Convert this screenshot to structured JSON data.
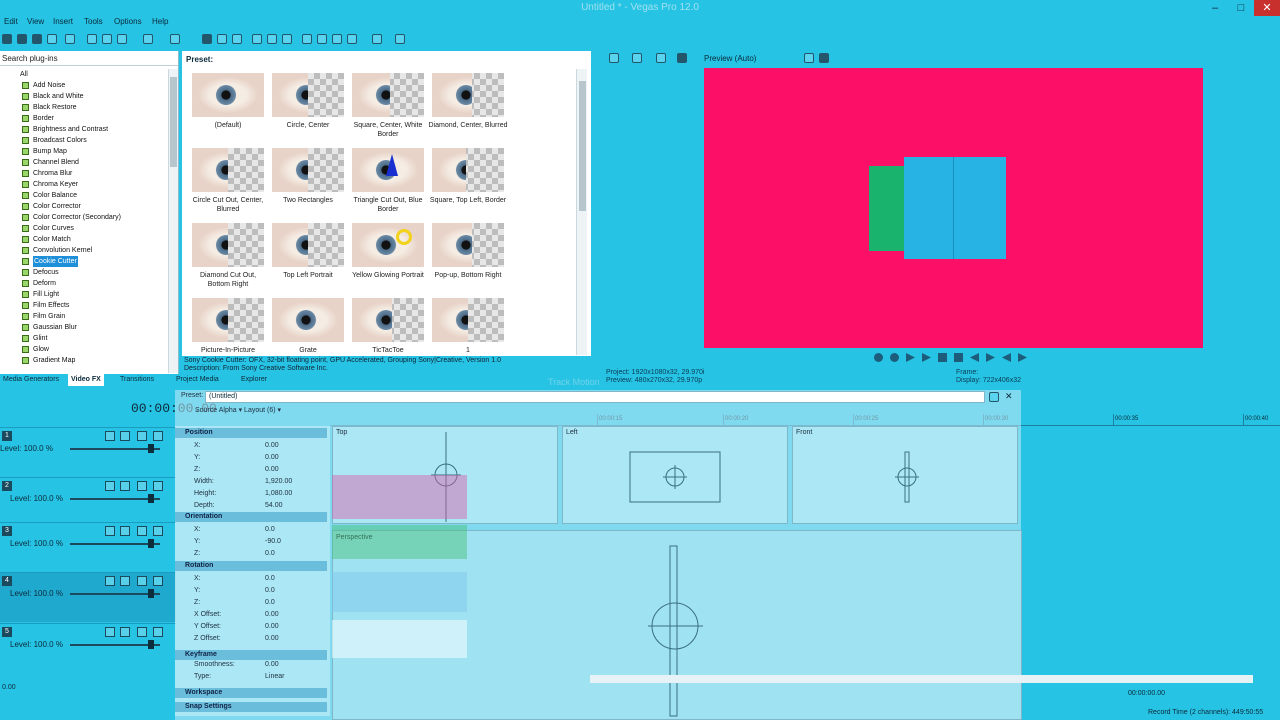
{
  "window": {
    "title": "Untitled * - Vegas Pro 12.0"
  },
  "menu": [
    "Edit",
    "View",
    "Insert",
    "Tools",
    "Options",
    "Help"
  ],
  "plugins": {
    "search_placeholder": "Search plug-ins",
    "root": "All",
    "items": [
      "Add Noise",
      "Black and White",
      "Black Restore",
      "Border",
      "Brightness and Contrast",
      "Broadcast Colors",
      "Bump Map",
      "Channel Blend",
      "Chroma Blur",
      "Chroma Keyer",
      "Color Balance",
      "Color Corrector",
      "Color Corrector (Secondary)",
      "Color Curves",
      "Color Match",
      "Convolution Kernel",
      "Cookie Cutter",
      "Defocus",
      "Deform",
      "Fill Light",
      "Film Effects",
      "Film Grain",
      "Gaussian Blur",
      "Glint",
      "Glow",
      "Gradient Map"
    ],
    "selected": "Cookie Cutter"
  },
  "presets": {
    "label": "Preset:",
    "items": [
      "(Default)",
      "Circle, Center",
      "Square, Center, White Border",
      "Diamond, Center, Blurred",
      "Circle Cut Out, Center, Blurred",
      "Two Rectangles",
      "Triangle Cut Out, Blue Border",
      "Square, Top Left, Border",
      "Diamond Cut Out, Bottom Right",
      "Top Left Portrait",
      "Yellow Glowing Portrait",
      "Pop-up, Bottom Right",
      "Picture-In-Picture",
      "Grate",
      "TicTacToe",
      "1"
    ],
    "description_line1": "Sony Cookie Cutter: OFX, 32-bit floating point, GPU Accelerated, Grouping Sony|Creative, Version 1.0",
    "description_line2": "Description: From Sony Creative Software Inc."
  },
  "bottom_tabs": [
    "Media Generators",
    "Video FX",
    "Transitions",
    "Project Media",
    "Explorer"
  ],
  "preview": {
    "mode": "Preview (Auto)",
    "project": "Project:   1920x1080x32, 29.970i",
    "preview": "Preview:  480x270x32, 29.970p",
    "frame_label": "Frame:",
    "display": "Display:   722x406x32",
    "bg_color": "#fb0f67",
    "shape_colors": [
      "#1ab36e",
      "#27b3e4"
    ]
  },
  "timeline": {
    "time": "00:00:00.00",
    "ruler": [
      "00:00:15",
      "00:00:20",
      "00:00:25",
      "00:00:30",
      "00:00:35",
      "00:00:40"
    ],
    "tracks": [
      {
        "num": "1",
        "level": "Level: 100.0 %"
      },
      {
        "num": "2",
        "level": "Level: 100.0 %"
      },
      {
        "num": "3",
        "level": "Level: 100.0 %"
      },
      {
        "num": "4",
        "level": "Level: 100.0 %"
      },
      {
        "num": "5",
        "level": "Level: 100.0 %"
      }
    ],
    "rate": "0.00",
    "end_time": "00:00:00.00",
    "record_time": "Record Time (2 channels): 449:50:55",
    "track_motion": "Track Motion"
  },
  "cc": {
    "preset_label": "Preset:",
    "preset_value": "(Untitled)",
    "toolbar": "Source Alpha  ▾   Layout (6)  ▾",
    "sections": [
      "Position",
      "Orientation",
      "Rotation",
      "Keyframe",
      "Workspace",
      "Snap Settings"
    ],
    "params": [
      {
        "n": "X:",
        "v": "0.00"
      },
      {
        "n": "Y:",
        "v": "0.00"
      },
      {
        "n": "Z:",
        "v": "0.00"
      },
      {
        "n": "Width:",
        "v": "1,920.00"
      },
      {
        "n": "Height:",
        "v": "1,080.00"
      },
      {
        "n": "Depth:",
        "v": "54.00"
      },
      {
        "n": "X:",
        "v": "0.0"
      },
      {
        "n": "Y:",
        "v": "-90.0"
      },
      {
        "n": "Z:",
        "v": "0.0"
      },
      {
        "n": "X:",
        "v": "0.0"
      },
      {
        "n": "Y:",
        "v": "0.0"
      },
      {
        "n": "Z:",
        "v": "0.0"
      },
      {
        "n": "X Offset:",
        "v": "0.00"
      },
      {
        "n": "Y Offset:",
        "v": "0.00"
      },
      {
        "n": "Z Offset:",
        "v": "0.00"
      },
      {
        "n": "Smoothness:",
        "v": "0.00"
      },
      {
        "n": "Type:",
        "v": "Linear"
      }
    ],
    "views": [
      "Top",
      "Left",
      "Front"
    ],
    "perspective": "Perspective"
  }
}
